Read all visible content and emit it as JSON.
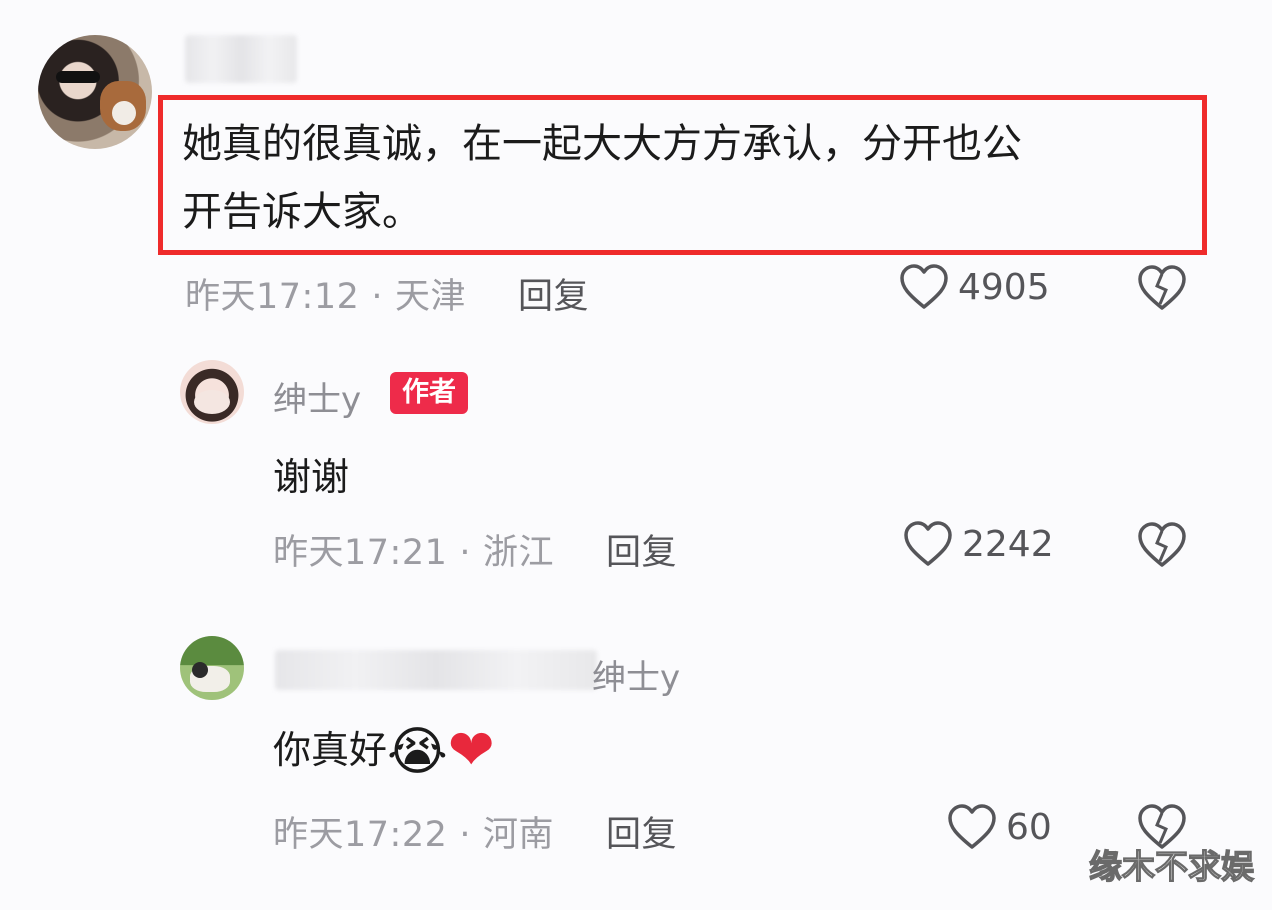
{
  "comments": [
    {
      "text_line1": "她真的很真诚，在一起大大方方承认，分开也公",
      "text_line2": "开告诉大家。",
      "time": "昨天17:12",
      "region": "天津",
      "reply_label": "回复",
      "likes": "4905"
    },
    {
      "username": "绅士y",
      "badge": "作者",
      "text": "谢谢",
      "time": "昨天17:21",
      "region": "浙江",
      "reply_label": "回复",
      "likes": "2242"
    },
    {
      "username_suffix": "绅士y",
      "text": "你真好",
      "emoji": "😭",
      "heart": "❤",
      "time": "昨天17:22",
      "region": "河南",
      "reply_label": "回复",
      "likes": "60"
    }
  ],
  "meta_separator": "·",
  "watermark": "缘木不求娱",
  "colors": {
    "highlight": "#ef2b2b",
    "badge": "#ee2b4a",
    "meta": "#9c9ca2"
  },
  "icons": [
    "heart-outline-icon",
    "broken-heart-icon"
  ]
}
